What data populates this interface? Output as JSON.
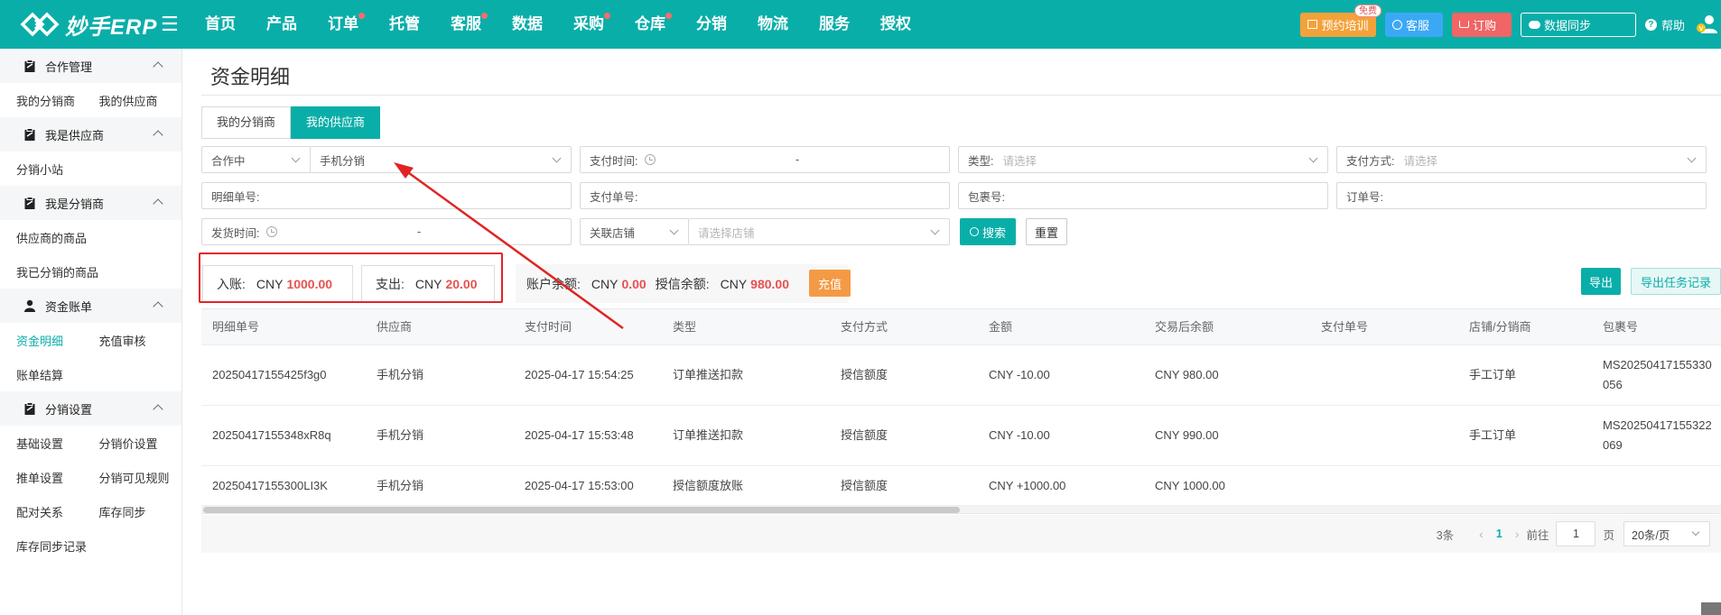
{
  "app": {
    "logo_text": "妙手ERP",
    "brand_color": "#0aaea9"
  },
  "nav": {
    "items": [
      {
        "label": "首页",
        "dot": false
      },
      {
        "label": "产品",
        "dot": false
      },
      {
        "label": "订单",
        "dot": true
      },
      {
        "label": "托管",
        "dot": false
      },
      {
        "label": "客服",
        "dot": true
      },
      {
        "label": "数据",
        "dot": false
      },
      {
        "label": "采购",
        "dot": true
      },
      {
        "label": "仓库",
        "dot": true
      },
      {
        "label": "分销",
        "dot": false
      },
      {
        "label": "物流",
        "dot": false
      },
      {
        "label": "服务",
        "dot": false
      },
      {
        "label": "授权",
        "dot": false
      }
    ],
    "train_label": "预约培训",
    "train_tag": "免费",
    "kefu_label": "客服",
    "order_label": "订购",
    "sync_label": "数据同步",
    "help_label": "帮助"
  },
  "sidebar": {
    "groups": [
      {
        "title": "合作管理",
        "items": [
          [
            "我的分销商",
            "我的供应商"
          ]
        ]
      },
      {
        "title": "我是供应商",
        "items": [
          [
            "分销小站"
          ]
        ]
      },
      {
        "title": "我是分销商",
        "items": [
          [
            "供应商的商品"
          ],
          [
            "我已分销的商品"
          ]
        ]
      },
      {
        "title": "资金账单",
        "items": [
          [
            "资金明细",
            "充值审核"
          ],
          [
            "账单结算"
          ]
        ]
      },
      {
        "title": "分销设置",
        "items": [
          [
            "基础设置",
            "分销价设置"
          ],
          [
            "推单设置",
            "分销可见规则"
          ],
          [
            "配对关系",
            "库存同步"
          ],
          [
            "库存同步记录"
          ]
        ]
      }
    ],
    "active_item": "资金明细"
  },
  "page": {
    "title": "资金明细",
    "tabs": [
      "我的分销商",
      "我的供应商"
    ],
    "active_tab": "我的供应商"
  },
  "filters": {
    "coop_status": "合作中",
    "partner": "手机分销",
    "pay_time_label": "支付时间:",
    "range_sep": "-",
    "type_label": "类型:",
    "type_placeholder": "请选择",
    "pay_method_label": "支付方式:",
    "pay_method_placeholder": "请选择",
    "detail_no_label": "明细单号:",
    "pay_no_label": "支付单号:",
    "package_no_label": "包裹号:",
    "order_no_label": "订单号:",
    "ship_time_label": "发货时间:",
    "store_select": "关联店铺",
    "store_placeholder": "请选择店铺",
    "search_label": "搜索",
    "reset_label": "重置"
  },
  "summary": {
    "income_label": "入账:",
    "income_currency": "CNY",
    "income_value": "1000.00",
    "expense_label": "支出:",
    "expense_currency": "CNY",
    "expense_value": "20.00",
    "balance_label": "账户余额:",
    "balance_currency": "CNY",
    "balance_value": "0.00",
    "credit_label": "授信余额:",
    "credit_currency": "CNY",
    "credit_value": "980.00",
    "charge_label": "充值",
    "export_label": "导出",
    "export_record_label": "导出任务记录"
  },
  "table": {
    "columns": [
      "明细单号",
      "供应商",
      "支付时间",
      "类型",
      "支付方式",
      "金额",
      "交易后余额",
      "支付单号",
      "店铺/分销商",
      "包裹号"
    ],
    "rows": [
      [
        "20250417155425f3g0",
        "手机分销",
        "2025-04-17 15:54:25",
        "订单推送扣款",
        "授信额度",
        "CNY -10.00",
        "CNY 980.00",
        "",
        "手工订单",
        "MS20250417155330056"
      ],
      [
        "20250417155348xR8q",
        "手机分销",
        "2025-04-17 15:53:48",
        "订单推送扣款",
        "授信额度",
        "CNY -10.00",
        "CNY 990.00",
        "",
        "手工订单",
        "MS20250417155322069"
      ],
      [
        "20250417155300LI3K",
        "手机分销",
        "2025-04-17 15:53:00",
        "授信额度放账",
        "授信额度",
        "CNY +1000.00",
        "CNY 1000.00",
        "",
        "",
        ""
      ]
    ]
  },
  "pager": {
    "total": "3条",
    "current": "1",
    "goto_label": "前往",
    "goto_value": "1",
    "page_unit": "页",
    "page_size": "20条/页"
  },
  "annotation_color": "#e02424"
}
